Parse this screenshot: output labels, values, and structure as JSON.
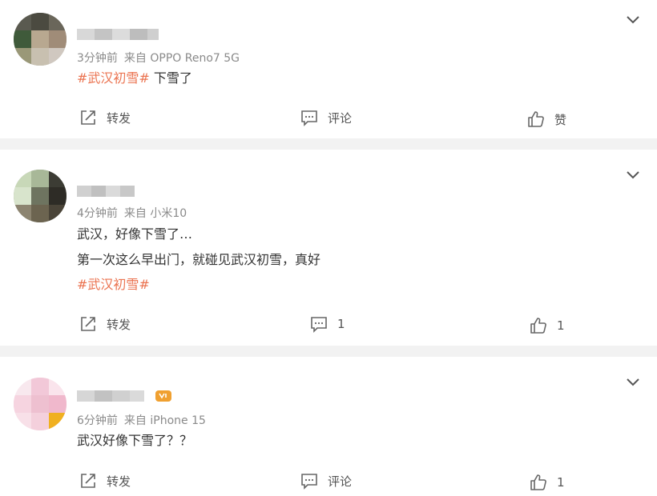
{
  "posts": [
    {
      "time": "3分钟前",
      "source": "来自 OPPO Reno7 5G",
      "hashtag": "#武汉初雪#",
      "text": " 下雪了",
      "actions": {
        "repost": "转发",
        "comment": "评论",
        "like": "赞"
      }
    },
    {
      "time": "4分钟前",
      "source": "来自 小米10",
      "line1": "武汉，好像下雪了…",
      "line2": "第一次这么早出门，就碰见武汉初雪，真好",
      "hashtag": "#武汉初雪#",
      "actions": {
        "repost": "转发",
        "comment": "1",
        "like": "1"
      }
    },
    {
      "time": "6分钟前",
      "source": "来自 iPhone 15",
      "text": "武汉好像下雪了？？",
      "actions": {
        "repost": "转发",
        "comment": "评论",
        "like": "1"
      }
    }
  ],
  "colors": {
    "hashtag": "#eb7350",
    "meta": "#8a8a8a",
    "separator": "#f2f2f2"
  },
  "icons": [
    "chevron-down-icon",
    "repost-icon",
    "comment-icon",
    "like-icon",
    "vip-badge-icon"
  ]
}
